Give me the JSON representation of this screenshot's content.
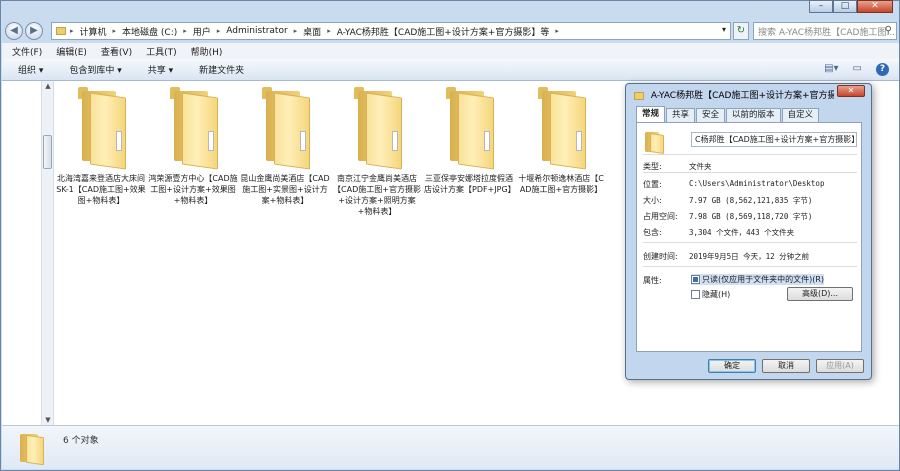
{
  "window": {
    "min": "–",
    "max": "□",
    "close": "✕"
  },
  "nav": {
    "back": "◀",
    "fwd": "▶"
  },
  "address": {
    "crumbs": [
      "计算机",
      "本地磁盘 (C:)",
      "用户",
      "Administrator",
      "桌面",
      "A-YAC杨邦胜【CAD施工图+设计方案+官方摄影】等"
    ],
    "sep": "▸",
    "drop": "▾",
    "refresh": "↻"
  },
  "search": {
    "placeholder": "搜索 A-YAC杨邦胜【CAD施工图..."
  },
  "menu": [
    "文件(F)",
    "编辑(E)",
    "查看(V)",
    "工具(T)",
    "帮助(H)"
  ],
  "toolbar": {
    "organize": "组织 ▾",
    "include": "包含到库中 ▾",
    "share": "共享 ▾",
    "newfolder": "新建文件夹",
    "help": "?"
  },
  "folders": [
    "北海湾嘉来登酒店大床间SK-1【CAD施工图+效果图+物料表】",
    "鸿荣源壹方中心【CAD施工图+设计方案+效果图+物料表】",
    "昆山金鹰尚美酒店【CAD施工图+实景图+设计方案+物料表】",
    "南京江宁金鹰尚美酒店【CAD施工图+官方摄影+设计方案+照明方案+物料表】",
    "三亚保亭安娜塔拉度假酒店设计方案【PDF+JPG】",
    "十堰希尔顿逸林酒店【CAD施工图+官方摄影】"
  ],
  "status": {
    "count": "6 个对象"
  },
  "dialog": {
    "title": "A-YAC杨邦胜【CAD施工图+设计方案+官方摄影】...",
    "close": "✕",
    "tabs": [
      "常规",
      "共享",
      "安全",
      "以前的版本",
      "自定义"
    ],
    "name": "C杨邦胜【CAD施工图+设计方案+官方摄影】等",
    "rows": [
      {
        "k": "类型:",
        "v": "文件夹"
      },
      {
        "k": "位置:",
        "v": "C:\\Users\\Administrator\\Desktop"
      },
      {
        "k": "大小:",
        "v": "7.97 GB (8,562,121,835 字节)"
      },
      {
        "k": "占用空间:",
        "v": "7.98 GB (8,569,118,720 字节)"
      },
      {
        "k": "包含:",
        "v": "3,304 个文件，443 个文件夹"
      },
      {
        "k": "创建时间:",
        "v": "2019年9月5日 今天，12 分钟之前"
      }
    ],
    "attr_label": "属性:",
    "readonly": "只读(仅应用于文件夹中的文件)(R)",
    "hidden": "隐藏(H)",
    "advanced": "高级(D)...",
    "ok": "确定",
    "cancel": "取消",
    "apply": "应用(A)"
  }
}
